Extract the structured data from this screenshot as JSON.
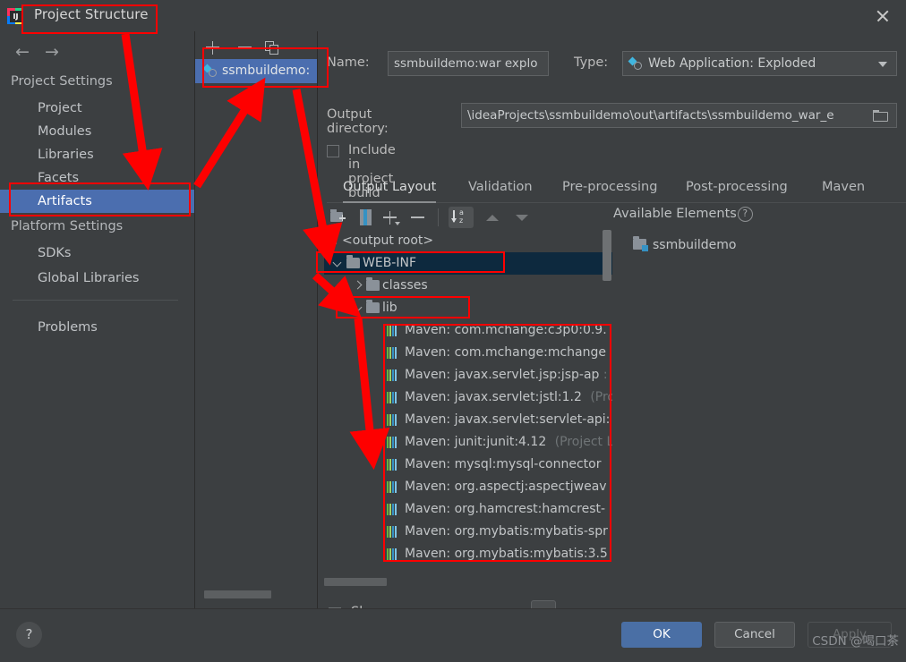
{
  "window": {
    "title": "Project Structure",
    "logo_icon": "intellij-idea-logo",
    "close_icon": "close-icon"
  },
  "sidebar": {
    "back_icon": "arrow-left-icon",
    "forward_icon": "arrow-right-icon",
    "groups": [
      {
        "label": "Project Settings",
        "items": [
          {
            "label": "Project",
            "selected": false
          },
          {
            "label": "Modules",
            "selected": false
          },
          {
            "label": "Libraries",
            "selected": false
          },
          {
            "label": "Facets",
            "selected": false
          },
          {
            "label": "Artifacts",
            "selected": true
          }
        ]
      },
      {
        "label": "Platform Settings",
        "items": [
          {
            "label": "SDKs",
            "selected": false
          },
          {
            "label": "Global Libraries",
            "selected": false
          }
        ]
      }
    ],
    "problems_label": "Problems"
  },
  "artifacts_panel": {
    "toolbar": [
      {
        "icon": "plus-icon",
        "name": "add-artifact-button"
      },
      {
        "icon": "minus-icon",
        "name": "remove-artifact-button"
      },
      {
        "icon": "copy-icon",
        "name": "copy-artifact-button"
      }
    ],
    "items": [
      {
        "label": "ssmbuildemo:",
        "icon": "web-artifact-icon",
        "selected": true
      }
    ]
  },
  "details": {
    "name_label": "Name:",
    "name_value": "ssmbuildemo:war explo",
    "type_label": "Type:",
    "type_value": "Web Application: Exploded",
    "type_icon": "web-artifact-icon",
    "output_dir_label": "Output directory:",
    "output_dir_value": "\\ideaProjects\\ssmbuildemo\\out\\artifacts\\ssmbuildemo_war_e",
    "output_dir_browse_icon": "folder-browse-icon",
    "include_in_build_label": "Include in project build",
    "include_in_build_checked": false,
    "tabs": [
      {
        "label": "Output Layout",
        "active": true
      },
      {
        "label": "Validation",
        "active": false
      },
      {
        "label": "Pre-processing",
        "active": false
      },
      {
        "label": "Post-processing",
        "active": false
      },
      {
        "label": "Maven",
        "active": false
      }
    ]
  },
  "layout_toolbar": [
    {
      "icon": "add-directory-icon",
      "name": "create-directory-button"
    },
    {
      "icon": "add-archive-icon",
      "name": "create-archive-button"
    },
    {
      "icon": "plus-dropdown-icon",
      "name": "add-copy-of-button"
    },
    {
      "icon": "minus-icon",
      "name": "remove-element-button"
    },
    {
      "icon": "sort-az-icon",
      "name": "sort-button"
    },
    {
      "icon": "arrow-up-icon",
      "name": "move-up-button"
    },
    {
      "icon": "arrow-down-icon",
      "name": "move-down-button"
    }
  ],
  "output_tree": [
    {
      "label": "<output root>",
      "icon": "artifact-root-icon",
      "indent": 0,
      "twisty": "none",
      "selected": false,
      "note": ""
    },
    {
      "label": "WEB-INF",
      "icon": "folder-icon",
      "indent": 1,
      "twisty": "open",
      "selected": true,
      "note": ""
    },
    {
      "label": "classes",
      "icon": "folder-icon",
      "indent": 2,
      "twisty": "closed",
      "selected": false,
      "note": ""
    },
    {
      "label": "lib",
      "icon": "folder-icon",
      "indent": 2,
      "twisty": "open",
      "selected": false,
      "note": ""
    },
    {
      "label": "Maven: com.mchange:c3p0:0.9.",
      "icon": "library-icon",
      "indent": 3,
      "twisty": "none",
      "selected": false,
      "note": ""
    },
    {
      "label": "Maven: com.mchange:mchange",
      "icon": "library-icon",
      "indent": 3,
      "twisty": "none",
      "selected": false,
      "note": ""
    },
    {
      "label": "Maven: javax.servlet.jsp:jsp-ap",
      "icon": "library-icon",
      "indent": 3,
      "twisty": "none",
      "selected": false,
      "note": ":"
    },
    {
      "label": "Maven: javax.servlet:jstl:1.2",
      "icon": "library-icon",
      "indent": 3,
      "twisty": "none",
      "selected": false,
      "note": "(Pro"
    },
    {
      "label": "Maven: javax.servlet:servlet-api:",
      "icon": "library-icon",
      "indent": 3,
      "twisty": "none",
      "selected": false,
      "note": ""
    },
    {
      "label": "Maven: junit:junit:4.12",
      "icon": "library-icon",
      "indent": 3,
      "twisty": "none",
      "selected": false,
      "note": "(Project L"
    },
    {
      "label": "Maven: mysql:mysql-connector",
      "icon": "library-icon",
      "indent": 3,
      "twisty": "none",
      "selected": false,
      "note": ""
    },
    {
      "label": "Maven: org.aspectj:aspectjweav",
      "icon": "library-icon",
      "indent": 3,
      "twisty": "none",
      "selected": false,
      "note": ""
    },
    {
      "label": "Maven: org.hamcrest:hamcrest-",
      "icon": "library-icon",
      "indent": 3,
      "twisty": "none",
      "selected": false,
      "note": ""
    },
    {
      "label": "Maven: org.mybatis:mybatis-spr",
      "icon": "library-icon",
      "indent": 3,
      "twisty": "none",
      "selected": false,
      "note": ""
    },
    {
      "label": "Maven: org.mybatis:mybatis:3.5",
      "icon": "library-icon",
      "indent": 3,
      "twisty": "none",
      "selected": false,
      "note": ""
    }
  ],
  "available": {
    "title": "Available Elements",
    "help_icon": "question-mark-icon",
    "items": [
      {
        "label": "ssmbuildemo",
        "icon": "module-icon"
      }
    ]
  },
  "footer_options": {
    "show_content_label": "Show content of elements",
    "show_content_checked": false,
    "ellipsis_label": "..."
  },
  "bottom_bar": {
    "help_label": "?",
    "ok_label": "OK",
    "cancel_label": "Cancel",
    "apply_label": "Apply"
  },
  "watermark": "CSDN @喝口茶",
  "colors": {
    "background": "#3c3f41",
    "selection_blue": "#4b6eaf",
    "tree_selection": "#0d293e",
    "annotation_red": "#fe0000",
    "primary_button": "#4a6fa5"
  }
}
